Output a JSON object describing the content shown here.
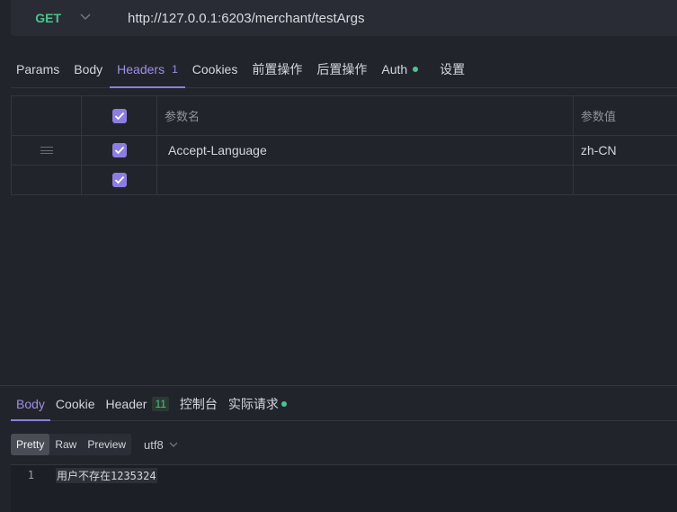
{
  "request": {
    "method": "GET",
    "url": "http://127.0.0.1:6203/merchant/testArgs"
  },
  "request_tabs": [
    {
      "label": "Params"
    },
    {
      "label": "Body"
    },
    {
      "label": "Headers",
      "count": "1",
      "active": true
    },
    {
      "label": "Cookies"
    },
    {
      "label": "前置操作"
    },
    {
      "label": "后置操作"
    },
    {
      "label": "Auth",
      "dot": true
    },
    {
      "label": "设置"
    }
  ],
  "headers_table": {
    "col_key": "参数名",
    "col_value": "参数值",
    "rows": [
      {
        "key": "Accept-Language",
        "value": "zh-CN",
        "checked": true
      },
      {
        "key": "",
        "value": "",
        "checked": true
      }
    ]
  },
  "response_tabs": [
    {
      "label": "Body",
      "active": true
    },
    {
      "label": "Cookie"
    },
    {
      "label": "Header",
      "count": "11"
    },
    {
      "label": "控制台"
    },
    {
      "label": "实际请求",
      "dot": true
    }
  ],
  "view_modes": [
    "Pretty",
    "Raw",
    "Preview"
  ],
  "active_view_mode": "Pretty",
  "encoding": "utf8",
  "response_body": [
    {
      "line": "1",
      "text": "用户不存在1235324"
    }
  ],
  "colors": {
    "accent": "#8c7ee0",
    "method_get": "#4cc38a",
    "background": "#22242c"
  }
}
